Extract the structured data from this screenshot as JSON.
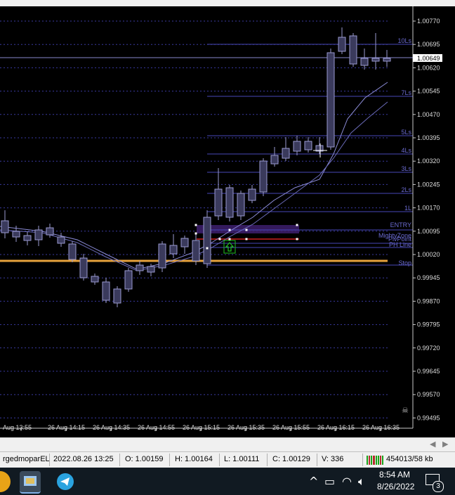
{
  "chart": {
    "price_labels": [
      "1.00770",
      "1.00695",
      "1.00620",
      "1.00545",
      "1.00470",
      "1.00395",
      "1.00320",
      "1.00245",
      "1.00170",
      "1.00095",
      "1.00020",
      "0.99945",
      "0.99870",
      "0.99795",
      "0.99720",
      "0.99645",
      "0.99570",
      "0.99495"
    ],
    "current_price": "1.00649",
    "time_labels": [
      "Aug 13:55",
      "26 Aug 14:15",
      "26 Aug 14:35",
      "26 Aug 14:55",
      "26 Aug 15:15",
      "26 Aug 15:35",
      "26 Aug 15:55",
      "26 Aug 16:15",
      "26 Aug 16:35"
    ],
    "level_labels": {
      "l10": "10Ls",
      "l7": "7Ls",
      "l5": "5Ls",
      "l4": "4Ls",
      "l3": "3Ls",
      "l2": "2Ls",
      "l1": "1L",
      "entry": "ENTRY",
      "mighty": "MightyZone",
      "pivot": "PivPoint",
      "pline": "PH Line",
      "stop": "Stop"
    },
    "colors": {
      "background": "#000000",
      "candle_body": "#3a3a5c",
      "candle_outline": "#9a9ad0",
      "level_line": "#4848b8",
      "ma_line": "#8c8cd8",
      "stop_line": "#e6a23c",
      "entry_zone": "#3d1e6d",
      "entry_red": "#d02020",
      "arrow": "#20c020"
    }
  },
  "status_bar": {
    "symbol": "rgedmoparEL",
    "datetime": "2022.08.26 13:25",
    "open": "O: 1.00159",
    "high": "H: 1.00164",
    "low": "L: 1.00111",
    "close": "C: 1.00129",
    "volume": "V: 336",
    "traffic": "454013/58 kb"
  },
  "taskbar": {
    "time": "8:54 AM",
    "date": "8/26/2022",
    "notifications": "3",
    "icons": [
      "app-icon",
      "telegram-icon"
    ],
    "tray_icons": [
      "chevron-up-icon",
      "battery-icon",
      "wifi-icon",
      "volume-icon",
      "notification-icon"
    ]
  }
}
